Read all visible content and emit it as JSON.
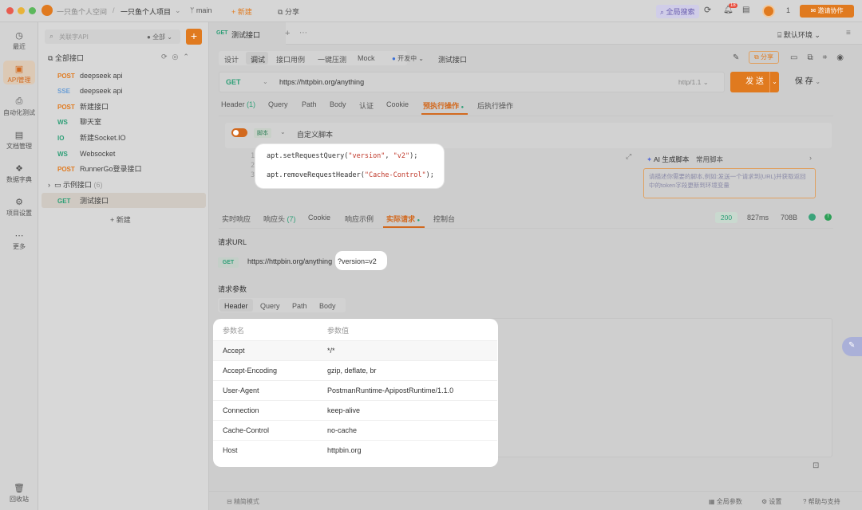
{
  "topbar": {
    "workspace": "一只鱼个人空间",
    "project": "一只鱼个人项目",
    "branch": "main",
    "new_label": "新建",
    "share_label": "分享",
    "search_label": "全局搜索",
    "badge": "18",
    "avatar_number": "1",
    "collab_label": "邀请协作"
  },
  "rail": {
    "items": [
      {
        "icon": "clock-icon",
        "label": "最近"
      },
      {
        "icon": "api-icon",
        "label": "API管理"
      },
      {
        "icon": "test-icon",
        "label": "自动化测试"
      },
      {
        "icon": "doc-icon",
        "label": "文档管理"
      },
      {
        "icon": "dictionary-icon",
        "label": "数据字典"
      },
      {
        "icon": "settings-icon",
        "label": "项目设置"
      },
      {
        "icon": "more-icon",
        "label": "更多"
      }
    ],
    "trash": "回收站"
  },
  "tree": {
    "search_placeholder": "关联字API",
    "filter_label": "全部",
    "all_label": "全部接口",
    "items": [
      {
        "method": "POST",
        "color": "#e07a1f",
        "name": "deepseek api"
      },
      {
        "method": "SSE",
        "color": "#6a9ed6",
        "name": "deepseek api"
      },
      {
        "method": "POST",
        "color": "#e07a1f",
        "name": "新建接口"
      },
      {
        "method": "WS",
        "color": "#2e9f77",
        "name": "聊天室"
      },
      {
        "method": "IO",
        "color": "#2e9f77",
        "name": "新建Socket.IO"
      },
      {
        "method": "WS",
        "color": "#2e9f77",
        "name": "Websocket"
      },
      {
        "method": "POST",
        "color": "#e07a1f",
        "name": "RunnerGo登录接口"
      }
    ],
    "folder_name": "示例接口",
    "folder_count": "(6)",
    "active_item": {
      "method": "GET",
      "color": "#2e9f77",
      "name": "测试接口"
    },
    "new_label": "新建"
  },
  "main": {
    "tab_method": "GET",
    "tab_title": "测试接口",
    "env_label": "默认环境",
    "subtabs": [
      "设计",
      "调试",
      "接口用例",
      "一键压测",
      "Mock"
    ],
    "status_label": "开发中",
    "api_name": "测试接口",
    "share_label": "分享",
    "url_method": "GET",
    "url": "https://httpbin.org/anything",
    "http_version": "http/1.1",
    "send_label": "发 送",
    "save_label": "保 存",
    "req_tabs": [
      "Header",
      "Query",
      "Path",
      "Body",
      "认证",
      "Cookie",
      "预执行操作",
      "后执行操作"
    ],
    "header_count": "(1)",
    "script_tag": "脚本",
    "script_title": "自定义脚本",
    "code_lines": [
      {
        "num": "1",
        "pre": "apt.setRequestQuery(",
        "s1": "\"version\"",
        "mid": ", ",
        "s2": "\"v2\"",
        "post": ");"
      },
      {
        "num": "2",
        "pre": "",
        "s1": "",
        "mid": "",
        "s2": "",
        "post": ""
      },
      {
        "num": "3",
        "pre": "apt.removeRequestHeader(",
        "s1": "\"Cache-Control\"",
        "mid": "",
        "s2": "",
        "post": ");"
      }
    ],
    "ai_label": "AI 生成脚本",
    "common_script": "常用脚本",
    "ai_hint": "请描述你需要的脚本,例如:发送一个请求到{URL}并获取返回中的token字段更新到环境变量",
    "resp_tabs": [
      "实时响应",
      "响应头",
      "Cookie",
      "响应示例",
      "实际请求",
      "控制台"
    ],
    "resp_header_count": "(7)",
    "status_code": "200",
    "time": "827ms",
    "size": "708B",
    "req_url_label": "请求URL",
    "actual_method": "GET",
    "actual_url": "https://httpbin.org/anything",
    "actual_query": "?version=v2",
    "params_label": "请求参数",
    "params_tabs": [
      "Header",
      "Query",
      "Path",
      "Body"
    ],
    "table": {
      "headers": [
        "参数名",
        "参数值"
      ],
      "rows": [
        [
          "Accept",
          "*/*"
        ],
        [
          "Accept-Encoding",
          "gzip, deflate, br"
        ],
        [
          "User-Agent",
          "PostmanRuntime-ApipostRuntime/1.1.0"
        ],
        [
          "Connection",
          "keep-alive"
        ],
        [
          "Cache-Control",
          "no-cache"
        ],
        [
          "Host",
          "httpbin.org"
        ]
      ]
    },
    "footer": {
      "left": "精简模式",
      "global": "全局参数",
      "settings": "设置",
      "help": "帮助与支持"
    }
  },
  "colors": {
    "accent": "#e07a1f",
    "get": "#2e9f77"
  }
}
